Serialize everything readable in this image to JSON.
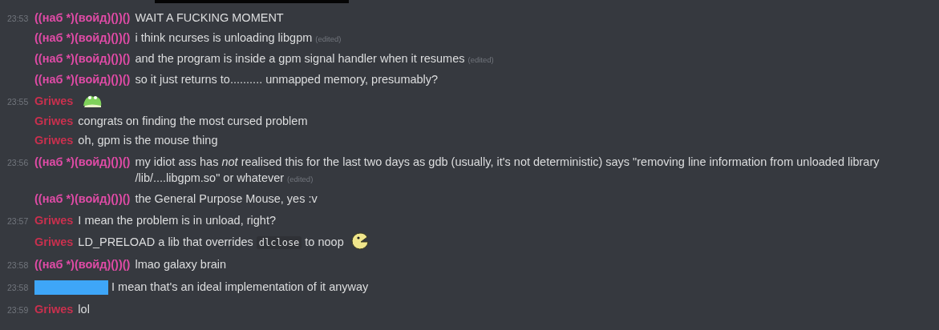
{
  "top_bar": {
    "kind": "redacted"
  },
  "messages": [
    {
      "time": "23:53",
      "author": {
        "kind": "name",
        "name": "((наб *)(войд)())()",
        "color": "#e04ba6"
      },
      "parts": [
        {
          "kind": "text",
          "text": "WAIT A FUCKING MOMENT"
        }
      ]
    },
    {
      "author": {
        "kind": "name",
        "name": "((наб *)(войд)())()",
        "color": "#e04ba6"
      },
      "parts": [
        {
          "kind": "text",
          "text": "i think ncurses is unloading libgpm"
        }
      ],
      "edited": "(edited)"
    },
    {
      "author": {
        "kind": "name",
        "name": "((наб *)(войд)())()",
        "color": "#e04ba6"
      },
      "parts": [
        {
          "kind": "text",
          "text": "and the program is inside a gpm signal handler when it resumes"
        }
      ],
      "edited": "(edited)"
    },
    {
      "author": {
        "kind": "name",
        "name": "((наб *)(войд)())()",
        "color": "#e04ba6"
      },
      "parts": [
        {
          "kind": "text",
          "text": "so it just returns to.......... unmapped memory, presumably?"
        }
      ]
    },
    {
      "time": "23:55",
      "author": {
        "kind": "name",
        "name": "Griwes",
        "color": "#c9304e"
      },
      "parts": [
        {
          "kind": "frog"
        }
      ]
    },
    {
      "author": {
        "kind": "name",
        "name": "Griwes",
        "color": "#c9304e"
      },
      "parts": [
        {
          "kind": "text",
          "text": "congrats on finding the most cursed problem"
        }
      ]
    },
    {
      "author": {
        "kind": "name",
        "name": "Griwes",
        "color": "#c9304e"
      },
      "parts": [
        {
          "kind": "text",
          "text": "oh, gpm is the mouse thing"
        }
      ]
    },
    {
      "time": "23:56",
      "author": {
        "kind": "name",
        "name": "((наб *)(войд)())()",
        "color": "#e04ba6"
      },
      "parts": [
        {
          "kind": "text",
          "text": "my idiot ass has *not* realised this for the last two days as gdb (usually, it's not deterministic) says \"removing line information from unloaded library /lib/....libgpm.so\" or whatever"
        }
      ],
      "edited": "(edited)"
    },
    {
      "author": {
        "kind": "name",
        "name": "((наб *)(войд)())()",
        "color": "#e04ba6"
      },
      "parts": [
        {
          "kind": "text",
          "text": "the General Purpose Mouse, yes :v"
        }
      ]
    },
    {
      "time": "23:57",
      "author": {
        "kind": "name",
        "name": "Griwes",
        "color": "#c9304e"
      },
      "parts": [
        {
          "kind": "text",
          "text": "I mean the problem is in unload, right?"
        }
      ]
    },
    {
      "author": {
        "kind": "name",
        "name": "Griwes",
        "color": "#c9304e"
      },
      "parts": [
        {
          "kind": "text",
          "text": "LD_PRELOAD a lib that overrides"
        },
        {
          "kind": "code",
          "text": "dlclose"
        },
        {
          "kind": "text",
          "text": "to noop"
        },
        {
          "kind": "grin"
        }
      ]
    },
    {
      "time": "23:58",
      "author": {
        "kind": "name",
        "name": "((наб *)(войд)())()",
        "color": "#e04ba6"
      },
      "parts": [
        {
          "kind": "text",
          "text": "lmao galaxy brain"
        }
      ]
    },
    {
      "time": "23:58",
      "author": {
        "kind": "redacted",
        "color": "#3ea6f8"
      },
      "parts": [
        {
          "kind": "text",
          "text": "I mean that's an ideal implementation of it anyway"
        }
      ]
    },
    {
      "time": "23:59",
      "author": {
        "kind": "name",
        "name": "Griwes",
        "color": "#c9304e"
      },
      "parts": [
        {
          "kind": "text",
          "text": "lol"
        }
      ]
    }
  ]
}
